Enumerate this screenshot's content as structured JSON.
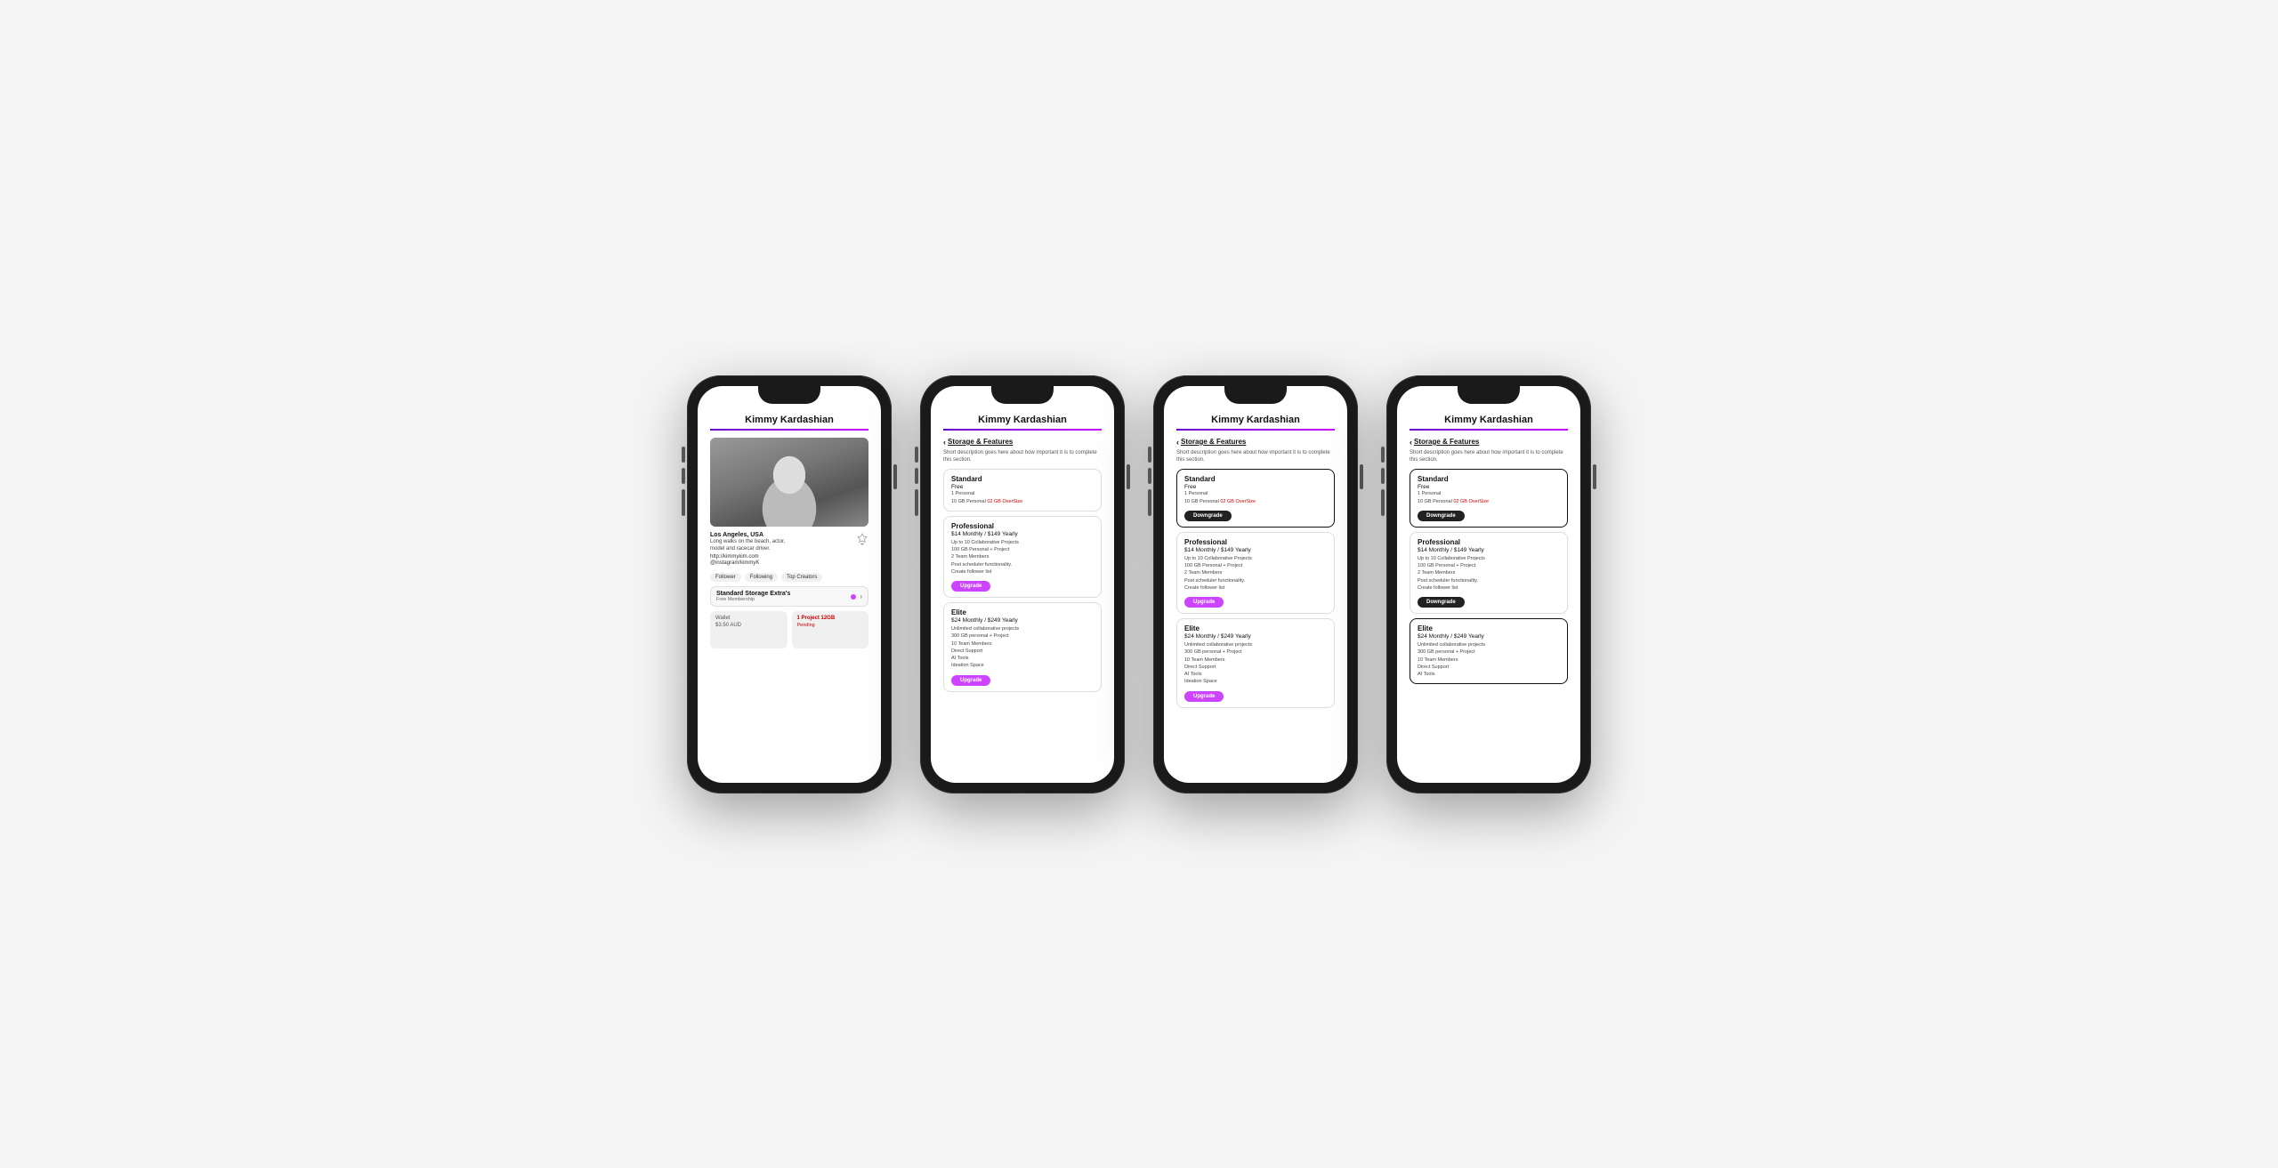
{
  "app": {
    "title": "Kimmy Kardashian",
    "tagline": "Los Angeles, USA",
    "bio": "Long walks on the beach, actor,\nmodel and racecar driver.",
    "link": "http://kimmykim.com",
    "instagram": "@instagram/kimmyK"
  },
  "tabs": {
    "follower": "Follower",
    "following": "Following",
    "top_creators": "Top Creators"
  },
  "storage": {
    "title": "Standard Storage Extra's",
    "subtitle": "Free Membership",
    "dot_color": "#cc44ff"
  },
  "wallet": {
    "label": "Wallet",
    "value": "$3.50 AUD"
  },
  "project": {
    "label": "1 Project 12GB",
    "status": "Pending"
  },
  "features_page": {
    "back": "Storage & Features",
    "description": "Short description goes here about how important it is to complete this section."
  },
  "plans": [
    {
      "name": "Standard",
      "price": "Free",
      "features": [
        "1 Personal",
        "10 GB Personal",
        "02 GB OverSize"
      ],
      "oversize_index": 2,
      "action": null
    },
    {
      "name": "Professional",
      "price": "$14 Monthly / $149 Yearly",
      "features": [
        "Up to 10 Collaborative Projects",
        "100 GB Personal + Project",
        "2 Team Members",
        "Post scheduler functionality.",
        "Create follower list"
      ],
      "action": "Upgrade"
    },
    {
      "name": "Elite",
      "price": "$24 Monthly / $249 Yearly",
      "features": [
        "Unlimited collaborative projects",
        "300 GB personal + Project",
        "10 Team Members",
        "Direct Support",
        "AI Tools",
        "Ideation Space"
      ],
      "action": "Upgrade"
    }
  ],
  "screen2": {
    "standard_action": "Downgrade",
    "professional_action": "Upgrade",
    "elite_action": "Upgrade",
    "selected": "professional"
  },
  "screen3": {
    "standard_action": "Downgrade",
    "professional_action": "Downgrade",
    "elite_action": "Upgrade",
    "selected": "elite"
  }
}
